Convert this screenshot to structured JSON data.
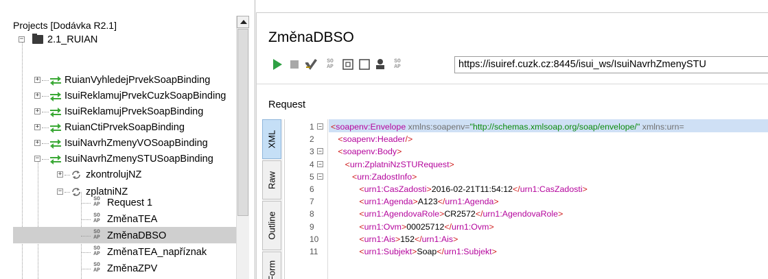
{
  "tree": {
    "title": "Projects [Dodávka R2.1]",
    "project": "2.1_RUIAN",
    "bindings": [
      "RuianVyhledejPrvekSoapBinding",
      "IsuiReklamujPrvekCuzkSoapBinding",
      "IsuiReklamujPrvekSoapBinding",
      "RuianCtiPrvekSoapBinding",
      "IsuiNavrhZmenyVOSoapBinding",
      "IsuiNavrhZmenySTUSoapBinding"
    ],
    "operations": [
      "zkontrolujNZ",
      "zplatniNZ"
    ],
    "requests": [
      "Request 1",
      "ZměnaTEA",
      "ZměnaDBSO",
      "ZměnaTEA_napříznak",
      "ZměnaZPV"
    ],
    "selected_request": "ZměnaDBSO",
    "soap_icon_top": "SO",
    "soap_icon_bottom": "AP"
  },
  "editor": {
    "title": "ZměnaDBSO",
    "url": "https://isuiref.cuzk.cz:8445/isui_ws/IsuiNavrhZmenySTU",
    "request_label": "Request",
    "side_tabs": [
      "XML",
      "Raw",
      "Outline",
      "Form"
    ],
    "active_tab": "XML"
  },
  "code": {
    "lines": [
      {
        "n": "1",
        "fold": "−",
        "parts": [
          [
            "br",
            "<"
          ],
          [
            "tag",
            "soapenv:Envelope"
          ],
          [
            "attr",
            " xmlns:soapenv="
          ],
          [
            "val",
            "\"http://schemas.xmlsoap.org/soap/envelope/\""
          ],
          [
            "attr",
            " xmlns:urn="
          ]
        ]
      },
      {
        "n": "2",
        "fold": "",
        "parts": [
          [
            "txt",
            "   "
          ],
          [
            "br",
            "<"
          ],
          [
            "tag",
            "soapenv:Header"
          ],
          [
            "br",
            "/>"
          ]
        ]
      },
      {
        "n": "3",
        "fold": "−",
        "parts": [
          [
            "txt",
            "   "
          ],
          [
            "br",
            "<"
          ],
          [
            "tag",
            "soapenv:Body"
          ],
          [
            "br",
            ">"
          ]
        ]
      },
      {
        "n": "4",
        "fold": "−",
        "parts": [
          [
            "txt",
            "      "
          ],
          [
            "br",
            "<"
          ],
          [
            "tag",
            "urn:ZplatniNzSTURequest"
          ],
          [
            "br",
            ">"
          ]
        ]
      },
      {
        "n": "5",
        "fold": "−",
        "parts": [
          [
            "txt",
            "         "
          ],
          [
            "br",
            "<"
          ],
          [
            "tag",
            "urn:ZadostInfo"
          ],
          [
            "br",
            ">"
          ]
        ]
      },
      {
        "n": "6",
        "fold": "",
        "parts": [
          [
            "txt",
            "            "
          ],
          [
            "br",
            "<"
          ],
          [
            "tag",
            "urn1:CasZadosti"
          ],
          [
            "br",
            ">"
          ],
          [
            "txt",
            "2016-02-21T11:54:12"
          ],
          [
            "br",
            "</"
          ],
          [
            "tag",
            "urn1:CasZadosti"
          ],
          [
            "br",
            ">"
          ]
        ]
      },
      {
        "n": "7",
        "fold": "",
        "parts": [
          [
            "txt",
            "            "
          ],
          [
            "br",
            "<"
          ],
          [
            "tag",
            "urn1:Agenda"
          ],
          [
            "br",
            ">"
          ],
          [
            "txt",
            "A123"
          ],
          [
            "br",
            "</"
          ],
          [
            "tag",
            "urn1:Agenda"
          ],
          [
            "br",
            ">"
          ]
        ]
      },
      {
        "n": "8",
        "fold": "",
        "parts": [
          [
            "txt",
            "            "
          ],
          [
            "br",
            "<"
          ],
          [
            "tag",
            "urn1:AgendovaRole"
          ],
          [
            "br",
            ">"
          ],
          [
            "txt",
            "CR2572"
          ],
          [
            "br",
            "</"
          ],
          [
            "tag",
            "urn1:AgendovaRole"
          ],
          [
            "br",
            ">"
          ]
        ]
      },
      {
        "n": "9",
        "fold": "",
        "parts": [
          [
            "txt",
            "            "
          ],
          [
            "br",
            "<"
          ],
          [
            "tag",
            "urn1:Ovm"
          ],
          [
            "br",
            ">"
          ],
          [
            "txt",
            "00025712"
          ],
          [
            "br",
            "</"
          ],
          [
            "tag",
            "urn1:Ovm"
          ],
          [
            "br",
            ">"
          ]
        ]
      },
      {
        "n": "10",
        "fold": "",
        "parts": [
          [
            "txt",
            "            "
          ],
          [
            "br",
            "<"
          ],
          [
            "tag",
            "urn1:Ais"
          ],
          [
            "br",
            ">"
          ],
          [
            "txt",
            "152"
          ],
          [
            "br",
            "</"
          ],
          [
            "tag",
            "urn1:Ais"
          ],
          [
            "br",
            ">"
          ]
        ]
      },
      {
        "n": "11",
        "fold": "",
        "parts": [
          [
            "txt",
            "            "
          ],
          [
            "br",
            "<"
          ],
          [
            "tag",
            "urn1:Subjekt"
          ],
          [
            "br",
            ">"
          ],
          [
            "txt",
            "Soap"
          ],
          [
            "br",
            "</"
          ],
          [
            "tag",
            "urn1:Subjekt"
          ],
          [
            "br",
            ">"
          ]
        ]
      }
    ]
  },
  "colors": {
    "run": "#2ea043",
    "arrows_green": "#3aa835",
    "selection": "#cfcfcf",
    "active_tab": "#c5dff6",
    "highlight_line": "#cfe0f5"
  }
}
